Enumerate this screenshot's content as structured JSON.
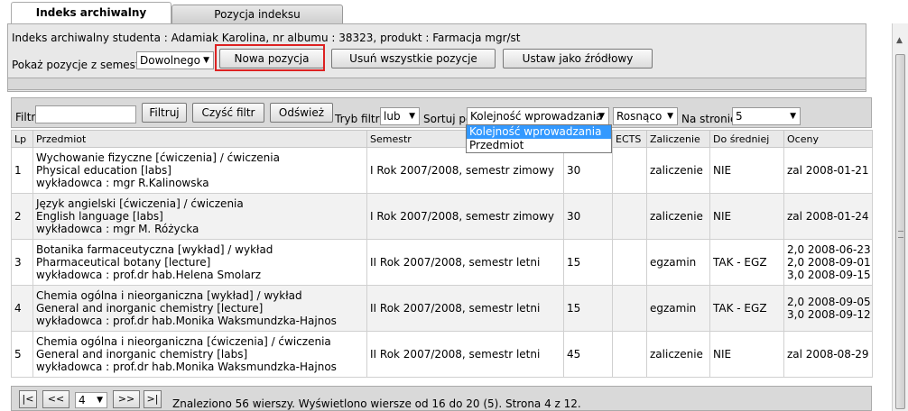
{
  "tabs": [
    {
      "label": "Indeks archiwalny"
    },
    {
      "label": "Pozycja indeksu"
    }
  ],
  "header": {
    "info": "Indeks archiwalny studenta : Adamiak Karolina, nr albumu : 38323, produkt : Farmacja mgr/st",
    "semester_label": "Pokaż pozycje z semestru",
    "semester_value": "Dowolnego",
    "btn_new": "Nowa pozycja",
    "btn_delete_all": "Usuń wszystkie pozycje",
    "btn_set_source": "Ustaw jako źródłowy"
  },
  "filter": {
    "filter_label": "Filtr",
    "filter_value": "",
    "btn_filter": "Filtruj",
    "btn_clear": "Czyść filtr",
    "btn_refresh": "Odśwież",
    "mode_label": "Tryb filtra",
    "mode_value": "lub",
    "sort_label": "Sortuj po",
    "sort_value": "Kolejność wprowadzania",
    "order_value": "Rosnąco",
    "per_page_label": "Na stronie",
    "per_page_value": "5",
    "sort_options": [
      "Kolejność wprowadzania",
      "Przedmiot"
    ]
  },
  "table": {
    "columns": [
      "Lp",
      "Przedmiot",
      "Semestr",
      "",
      "ECTS",
      "Zaliczenie",
      "Do średniej",
      "Oceny"
    ],
    "rows": [
      {
        "lp": "1",
        "l1": "Wychowanie fizyczne [ćwiczenia] / ćwiczenia",
        "l2": "Physical education [labs]",
        "l3": "wykładowca : mgr R.Kalinowska",
        "semestr": "I Rok 2007/2008, semestr zimowy",
        "hours": "30",
        "ects": "",
        "zal": "zaliczenie",
        "sr": "NIE",
        "oceny": [
          "zal 2008-01-21"
        ]
      },
      {
        "lp": "2",
        "l1": "Język angielski [ćwiczenia] / ćwiczenia",
        "l2": "English language [labs]",
        "l3": "wykładowca : mgr M. Różycka",
        "semestr": "I Rok 2007/2008, semestr zimowy",
        "hours": "30",
        "ects": "",
        "zal": "zaliczenie",
        "sr": "NIE",
        "oceny": [
          "zal 2008-01-24"
        ]
      },
      {
        "lp": "3",
        "l1": "Botanika farmaceutyczna [wykład] / wykład",
        "l2": "Pharmaceutical botany [lecture]",
        "l3": "wykładowca : prof.dr hab.Helena Smolarz",
        "semestr": "II Rok 2007/2008, semestr letni",
        "hours": "15",
        "ects": "",
        "zal": "egzamin",
        "sr": "TAK - EGZ",
        "oceny": [
          "2,0 2008-06-23",
          "2,0 2008-09-01",
          "3,0 2008-09-15"
        ]
      },
      {
        "lp": "4",
        "l1": "Chemia ogólna i nieorganiczna [wykład] / wykład",
        "l2": "General and inorganic chemistry [lecture]",
        "l3": "wykładowca : prof.dr hab.Monika Waksmundzka-Hajnos",
        "semestr": "II Rok 2007/2008, semestr letni",
        "hours": "15",
        "ects": "",
        "zal": "egzamin",
        "sr": "TAK - EGZ",
        "oceny": [
          "2,0 2008-09-05",
          "3,0 2008-09-12"
        ]
      },
      {
        "lp": "5",
        "l1": "Chemia ogólna i nieorganiczna [ćwiczenia] / ćwiczenia",
        "l2": "General and inorganic chemistry [labs]",
        "l3": "wykładowca : prof.dr hab.Monika Waksmundzka-Hajnos",
        "semestr": "II Rok 2007/2008, semestr letni",
        "hours": "45",
        "ects": "",
        "zal": "zaliczenie",
        "sr": "NIE",
        "oceny": [
          "zal 2008-08-29"
        ]
      }
    ]
  },
  "pager": {
    "first": "|<",
    "prev": "<<",
    "page": "4",
    "next": ">>",
    "last": ">|",
    "status": "Znaleziono 56 wierszy. Wyświetlono wiersze od 16 do 20 (5). Strona 4 z 12."
  },
  "colors": {
    "highlight": "#dd2222",
    "selected_option": "#3399ff"
  }
}
